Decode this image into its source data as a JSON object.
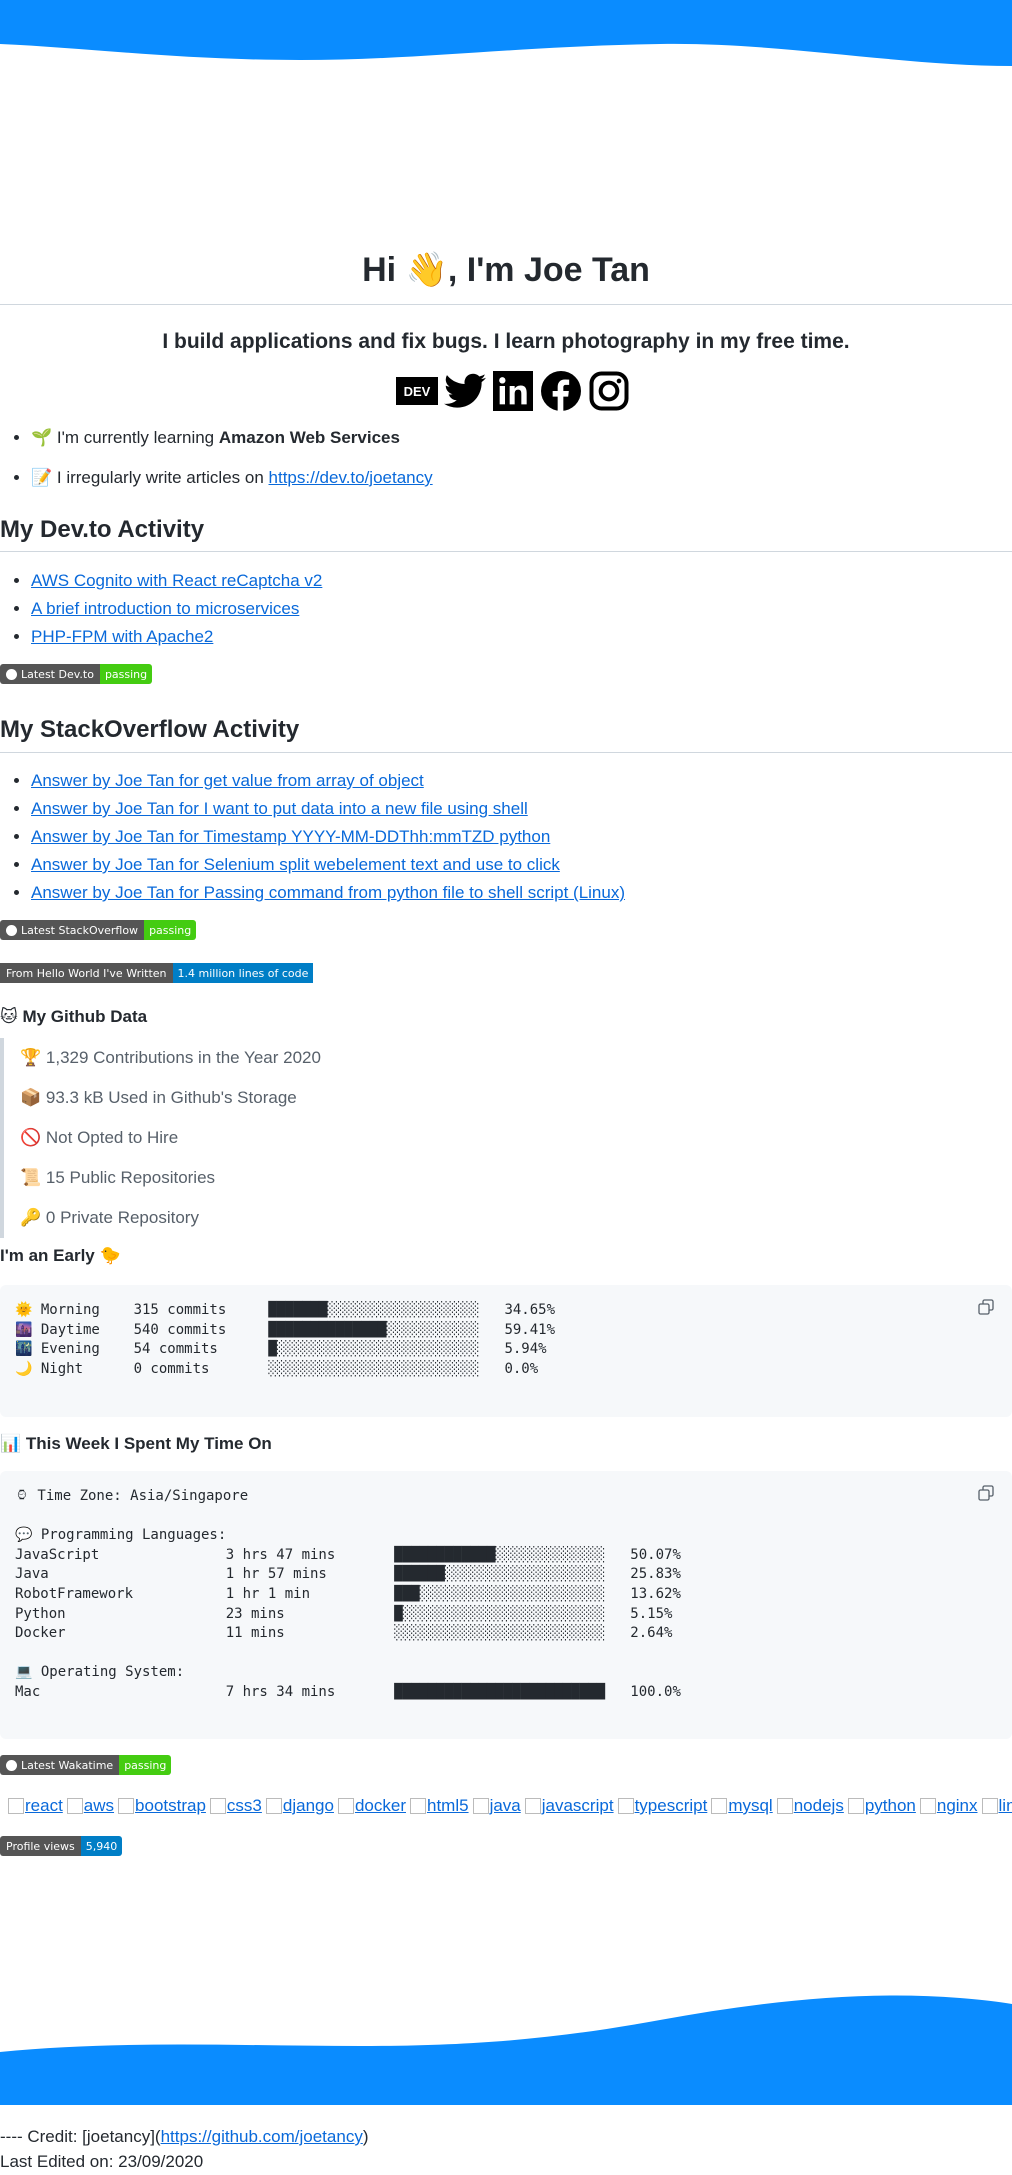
{
  "hero": {
    "title": "Hi 👋, I'm Joe Tan",
    "tagline": "I build applications and fix bugs. I learn photography in my free time."
  },
  "social": [
    {
      "name": "dev-icon",
      "label": "DEV"
    },
    {
      "name": "twitter-icon"
    },
    {
      "name": "linkedin-icon"
    },
    {
      "name": "facebook-icon"
    },
    {
      "name": "instagram-icon"
    }
  ],
  "about": {
    "learning_prefix": "🌱 I'm currently learning ",
    "learning_bold": "Amazon Web Services",
    "writing_prefix": "📝 I irregularly write articles on ",
    "writing_link": "https://dev.to/joetancy"
  },
  "devto": {
    "heading": "My Dev.to Activity",
    "articles": [
      "AWS Cognito with React reCaptcha v2",
      "A brief introduction to microservices",
      "PHP-FPM with Apache2"
    ],
    "badge_left": "Latest Dev.to",
    "badge_right": "passing"
  },
  "stackoverflow": {
    "heading": "My StackOverflow Activity",
    "answers": [
      "Answer by Joe Tan for get value from array of object",
      "Answer by Joe Tan for I want to put data into a new file using shell",
      "Answer by Joe Tan for Timestamp YYYY-MM-DDThh:mmTZD python",
      "Answer by Joe Tan for Selenium split webelement text and use to click",
      "Answer by Joe Tan for Passing command from python file to shell script (Linux)"
    ],
    "badge_left": "Latest StackOverflow",
    "badge_right": "passing"
  },
  "loc_badge": {
    "left": "From Hello World I've Written",
    "right": "1.4 million lines of code"
  },
  "github": {
    "heading": "🐱 My Github Data",
    "stats": [
      "🏆 1,329 Contributions in the Year 2020",
      "📦 93.3 kB Used in Github's Storage",
      "🚫 Not Opted to Hire",
      "📜 15 Public Repositories",
      "🔑 0 Private Repository"
    ]
  },
  "early": {
    "heading": "I'm an Early 🐤",
    "code": "🌞 Morning    315 commits     ███████░░░░░░░░░░░░░░░░░░   34.65% \n🌆 Daytime    540 commits     ██████████████░░░░░░░░░░░   59.41% \n🌃 Evening    54 commits      █░░░░░░░░░░░░░░░░░░░░░░░░   5.94% \n🌙 Night      0 commits       ░░░░░░░░░░░░░░░░░░░░░░░░░   0.0% \n"
  },
  "week": {
    "heading": "📊 This Week I Spent My Time On",
    "code": "⌚︎ Time Zone: Asia/Singapore\n\n💬 Programming Languages: \nJavaScript               3 hrs 47 mins       ████████████░░░░░░░░░░░░░   50.07% \nJava                     1 hr 57 mins        ██████░░░░░░░░░░░░░░░░░░░   25.83% \nRobotFramework           1 hr 1 min          ███░░░░░░░░░░░░░░░░░░░░░░   13.62% \nPython                   23 mins             █░░░░░░░░░░░░░░░░░░░░░░░░   5.15% \nDocker                   11 mins             ░░░░░░░░░░░░░░░░░░░░░░░░░   2.64% \n\n💻 Operating System: \nMac                      7 hrs 34 mins       █████████████████████████   100.0% \n",
    "badge_left": "Latest Wakatime",
    "badge_right": "passing"
  },
  "tech": [
    "react",
    "aws",
    "bootstrap",
    "css3",
    "django",
    "docker",
    "html5",
    "java",
    "javascript",
    "typescript",
    "mysql",
    "nodejs",
    "python",
    "nginx",
    "linux"
  ],
  "views_badge": {
    "left": "Profile views",
    "right": "5,940"
  },
  "footer": {
    "credit_prefix": "---- Credit: [joetancy](",
    "credit_link": "https://github.com/joetancy",
    "credit_suffix": ")",
    "edited": "Last Edited on: 23/09/2020"
  },
  "colors": {
    "wave": "#0a8cff",
    "badge_green": "#44cc11",
    "badge_blue": "#007ec6",
    "link": "#0969da"
  }
}
